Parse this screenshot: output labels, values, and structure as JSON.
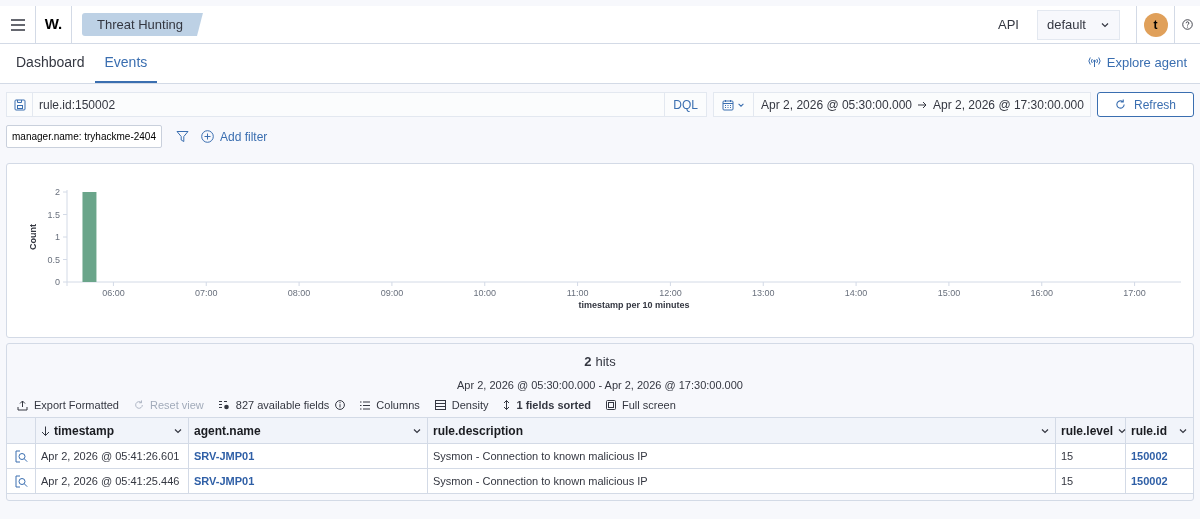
{
  "header": {
    "logo": "W.",
    "breadcrumb": "Threat Hunting",
    "api_label": "API",
    "space_select": "default",
    "avatar": "t"
  },
  "tabs": [
    {
      "label": "Dashboard",
      "selected": false
    },
    {
      "label": "Events",
      "selected": true
    }
  ],
  "explore_agent": "Explore agent",
  "query": {
    "value": "rule.id:150002",
    "language": "DQL"
  },
  "time_range": {
    "start": "Apr 2, 2026 @ 05:30:00.000",
    "end": "Apr 2, 2026 @ 17:30:00.000",
    "refresh": "Refresh"
  },
  "filters": [
    {
      "label": "manager.name: tryhackme-2404"
    }
  ],
  "add_filter": "Add filter",
  "histogram": {
    "chart_data": {
      "type": "bar",
      "xlabel": "timestamp per 10 minutes",
      "ylabel": "Count",
      "x": [
        5.75
      ],
      "series": [
        {
          "color": "#6aa58a",
          "values": [
            2
          ]
        }
      ],
      "xlim": [
        5.5,
        17.5
      ],
      "ylim": [
        0,
        2
      ],
      "xticks": [
        {
          "value": 6,
          "label": "06:00"
        },
        {
          "value": 7,
          "label": "07:00"
        },
        {
          "value": 8,
          "label": "08:00"
        },
        {
          "value": 9,
          "label": "09:00"
        },
        {
          "value": 10,
          "label": "10:00"
        },
        {
          "value": 11,
          "label": "11:00"
        },
        {
          "value": 12,
          "label": "12:00"
        },
        {
          "value": 13,
          "label": "13:00"
        },
        {
          "value": 14,
          "label": "14:00"
        },
        {
          "value": 15,
          "label": "15:00"
        },
        {
          "value": 16,
          "label": "16:00"
        },
        {
          "value": 17,
          "label": "17:00"
        }
      ],
      "yticks": [
        0,
        0.5,
        1,
        1.5,
        2
      ]
    }
  },
  "hits": {
    "count": "2",
    "label": "hits",
    "range": "Apr 2, 2026 @ 05:30:00.000 - Apr 2, 2026 @ 17:30:00.000"
  },
  "toolbar": [
    {
      "kind": "export",
      "label": "Export Formatted",
      "disabled": false
    },
    {
      "kind": "reset",
      "label": "Reset view",
      "disabled": true
    },
    {
      "kind": "fields",
      "label": "827 available fields",
      "disabled": false
    },
    {
      "kind": "columns",
      "label": "Columns",
      "disabled": false
    },
    {
      "kind": "density",
      "label": "Density",
      "disabled": false
    },
    {
      "kind": "sort",
      "label": "1 fields sorted",
      "disabled": false
    },
    {
      "kind": "fullscreen",
      "label": "Full screen",
      "disabled": false
    }
  ],
  "table": {
    "columns": [
      {
        "label": "timestamp",
        "sorted": true
      },
      {
        "label": "agent.name",
        "sorted": false
      },
      {
        "label": "rule.description",
        "sorted": false
      },
      {
        "label": "rule.level",
        "sorted": false
      },
      {
        "label": "rule.id",
        "sorted": false
      }
    ],
    "rows": [
      {
        "cells": [
          "Apr 2, 2026 @ 05:41:26.601",
          "SRV-JMP01",
          "Sysmon - Connection to known malicious IP",
          "15",
          "150002"
        ]
      },
      {
        "cells": [
          "Apr 2, 2026 @ 05:41:25.446",
          "SRV-JMP01",
          "Sysmon - Connection to known malicious IP",
          "15",
          "150002"
        ]
      }
    ]
  }
}
